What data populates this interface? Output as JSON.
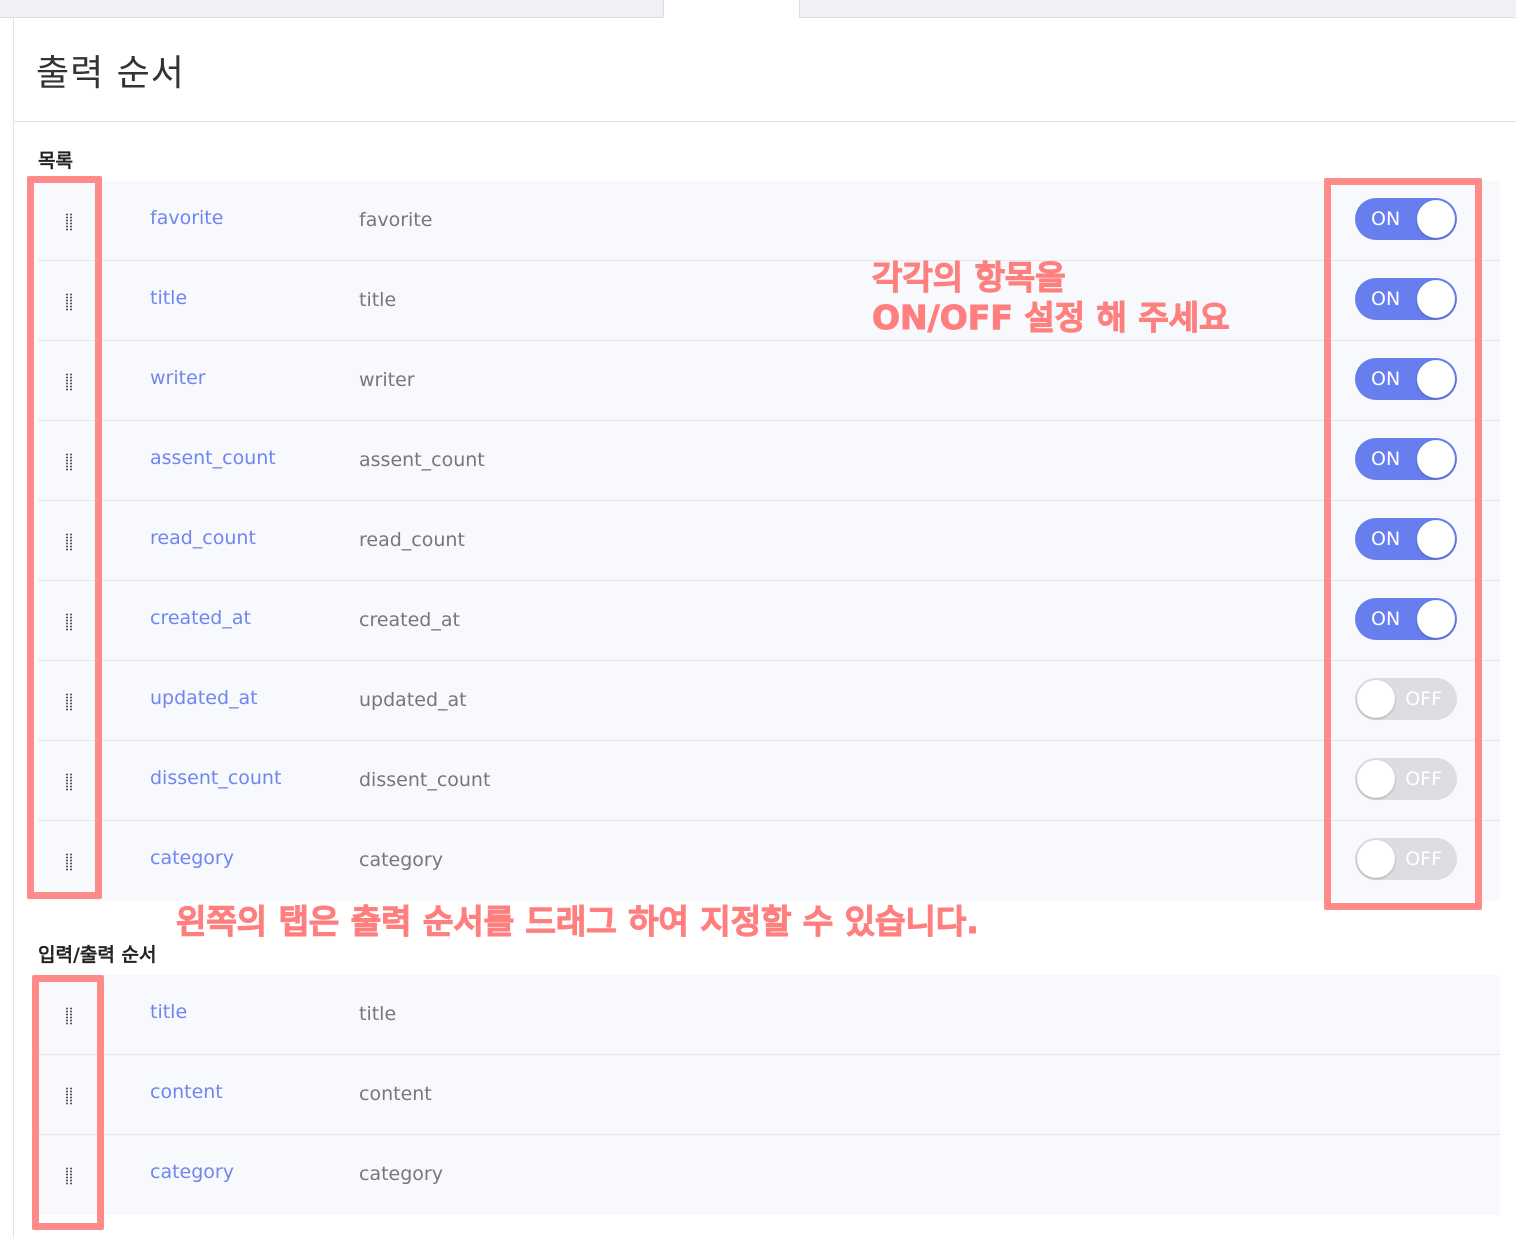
{
  "header": {
    "title": "출력 순서"
  },
  "list_section": {
    "label": "목록",
    "rows": [
      {
        "key": "favorite",
        "name": "favorite",
        "toggle": "ON"
      },
      {
        "key": "title",
        "name": "title",
        "toggle": "ON"
      },
      {
        "key": "writer",
        "name": "writer",
        "toggle": "ON"
      },
      {
        "key": "assent_count",
        "name": "assent_count",
        "toggle": "ON"
      },
      {
        "key": "read_count",
        "name": "read_count",
        "toggle": "ON"
      },
      {
        "key": "created_at",
        "name": "created_at",
        "toggle": "ON"
      },
      {
        "key": "updated_at",
        "name": "updated_at",
        "toggle": "OFF"
      },
      {
        "key": "dissent_count",
        "name": "dissent_count",
        "toggle": "OFF"
      },
      {
        "key": "category",
        "name": "category",
        "toggle": "OFF"
      }
    ]
  },
  "io_section": {
    "label": "입력/출력 순서",
    "rows": [
      {
        "key": "title",
        "name": "title"
      },
      {
        "key": "content",
        "name": "content"
      },
      {
        "key": "category",
        "name": "category"
      }
    ]
  },
  "annotations": {
    "toggle_note_line1": "각각의 항목을",
    "toggle_note_line2": "ON/OFF 설정 해 주세요",
    "drag_note": "왼쪽의 탭은 출력 순서를 드래그 하여 지정할 수 있습니다."
  },
  "colors": {
    "accent": "#667eee",
    "field_key": "#6f86f2",
    "annotation": "#ff8a8a",
    "toggle_off": "#dcdde0"
  },
  "icons": {
    "drag_handle": "drag-handle-icon"
  }
}
